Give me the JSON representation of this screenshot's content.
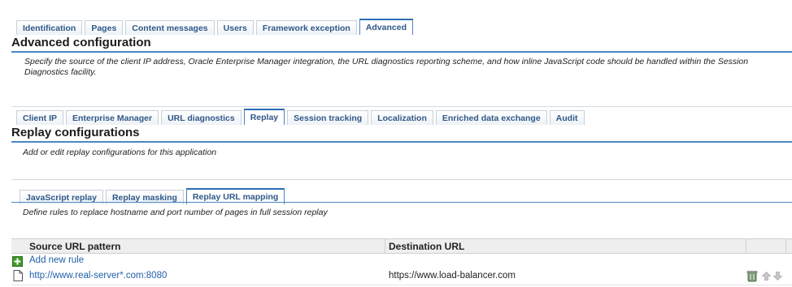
{
  "top_tabs": [
    "Identification",
    "Pages",
    "Content messages",
    "Users",
    "Framework exception",
    "Advanced"
  ],
  "top_active": 5,
  "advanced": {
    "title": "Advanced configuration",
    "description": "Specify the source of the client IP address, Oracle Enterprise Manager integration, the URL diagnostics reporting scheme, and how inline JavaScript code should be handled within the Session Diagnostics facility."
  },
  "sub_tabs": [
    "Client IP",
    "Enterprise Manager",
    "URL diagnostics",
    "Replay",
    "Session tracking",
    "Localization",
    "Enriched data exchange",
    "Audit"
  ],
  "sub_active": 3,
  "replay": {
    "title": "Replay configurations",
    "description": "Add or edit replay configurations for this application"
  },
  "replay_tabs": [
    "JavaScript replay",
    "Replay masking",
    "Replay URL mapping"
  ],
  "replay_active": 2,
  "mapping": {
    "description": "Define rules to replace hostname and port number of pages in full session replay",
    "columns": {
      "source": "Source URL pattern",
      "destination": "Destination URL"
    },
    "add_rule": "Add new rule",
    "rows": [
      {
        "source": "http://www.real-server*.com:8080",
        "destination": "https://www.load-balancer.com"
      }
    ]
  },
  "icons": {
    "add": "add-icon",
    "page": "page-icon",
    "delete": "trash-icon",
    "up": "arrow-up-icon",
    "down": "arrow-down-icon"
  }
}
